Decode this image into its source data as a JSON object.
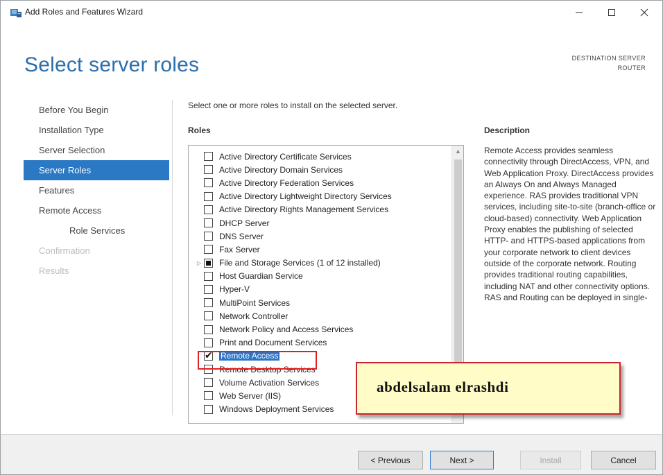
{
  "window": {
    "title": "Add Roles and Features Wizard",
    "icons": {
      "app": "server-manager-icon",
      "minimize": "minimize-icon",
      "maximize": "maximize-icon",
      "close": "close-icon"
    }
  },
  "header": {
    "page_title": "Select server roles",
    "destination_label": "DESTINATION SERVER",
    "destination_name": "ROUTER"
  },
  "nav": {
    "items": [
      {
        "label": "Before You Begin",
        "state": "normal"
      },
      {
        "label": "Installation Type",
        "state": "normal"
      },
      {
        "label": "Server Selection",
        "state": "normal"
      },
      {
        "label": "Server Roles",
        "state": "active"
      },
      {
        "label": "Features",
        "state": "normal"
      },
      {
        "label": "Remote Access",
        "state": "normal"
      },
      {
        "label": "Role Services",
        "state": "sub"
      },
      {
        "label": "Confirmation",
        "state": "disabled"
      },
      {
        "label": "Results",
        "state": "disabled"
      }
    ]
  },
  "main": {
    "instruction": "Select one or more roles to install on the selected server.",
    "roles_heading": "Roles",
    "description_heading": "Description",
    "roles": [
      {
        "label": "Active Directory Certificate Services",
        "checked": false
      },
      {
        "label": "Active Directory Domain Services",
        "checked": false
      },
      {
        "label": "Active Directory Federation Services",
        "checked": false
      },
      {
        "label": "Active Directory Lightweight Directory Services",
        "checked": false
      },
      {
        "label": "Active Directory Rights Management Services",
        "checked": false
      },
      {
        "label": "DHCP Server",
        "checked": false
      },
      {
        "label": "DNS Server",
        "checked": false
      },
      {
        "label": "Fax Server",
        "checked": false
      },
      {
        "label": "File and Storage Services (1 of 12 installed)",
        "checked": "partial",
        "expandable": true
      },
      {
        "label": "Host Guardian Service",
        "checked": false
      },
      {
        "label": "Hyper-V",
        "checked": false
      },
      {
        "label": "MultiPoint Services",
        "checked": false
      },
      {
        "label": "Network Controller",
        "checked": false
      },
      {
        "label": "Network Policy and Access Services",
        "checked": false
      },
      {
        "label": "Print and Document Services",
        "checked": false
      },
      {
        "label": "Remote Access",
        "checked": true,
        "selected": true
      },
      {
        "label": "Remote Desktop Services",
        "checked": false
      },
      {
        "label": "Volume Activation Services",
        "checked": false
      },
      {
        "label": "Web Server (IIS)",
        "checked": false
      },
      {
        "label": "Windows Deployment Services",
        "checked": false
      }
    ],
    "description": "Remote Access provides seamless connectivity through DirectAccess, VPN, and Web Application Proxy. DirectAccess provides an Always On and Always Managed experience. RAS provides traditional VPN services, including site-to-site (branch-office or cloud-based) connectivity. Web Application Proxy enables the publishing of selected HTTP- and HTTPS-based applications from your corporate network to client devices outside of the corporate network. Routing provides traditional routing capabilities, including NAT and other connectivity options. RAS and Routing can be deployed in single-"
  },
  "watermark": {
    "text": "abdelsalam elrashdi"
  },
  "footer": {
    "previous": "< Previous",
    "next": "Next >",
    "install": "Install",
    "cancel": "Cancel"
  },
  "colors": {
    "accent": "#2b79c4",
    "title_blue": "#2c6fab",
    "highlight_red": "#e02020",
    "watermark_bg": "#fffcc8"
  }
}
